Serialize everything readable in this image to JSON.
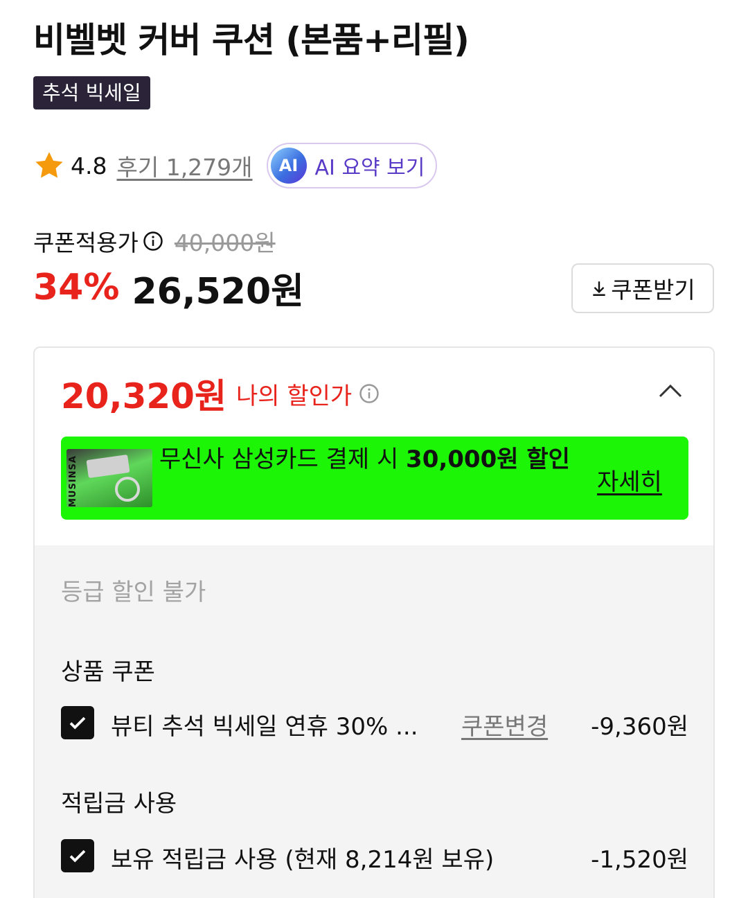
{
  "product": {
    "title": "비벨벳 커버 쿠션 (본품+리필)",
    "badge": "추석 빅세일"
  },
  "rating": {
    "icon": "star-icon",
    "value": "4.8",
    "review_link": "후기 1,279개",
    "ai_badge": "AI",
    "ai_summary_label": "AI 요약 보기"
  },
  "price": {
    "coupon_label": "쿠폰적용가",
    "original": "40,000원",
    "discount_rate": "34%",
    "sale": "26,520원",
    "coupon_button": "쿠폰받기"
  },
  "benefits": {
    "my_price": "20,320원",
    "my_price_label": "나의 할인가",
    "banner": {
      "image_brand": "MUSINSA",
      "text_prefix": "무신사 삼성카드 결제 시 ",
      "text_bold": "30,000원 할인",
      "detail_link": "자세히"
    },
    "grade_unavailable": "등급 할인 불가",
    "product_coupon_title": "상품 쿠폰",
    "product_coupon": {
      "checked": true,
      "text": "뷰티 추석 빅세일 연휴 30% ...",
      "change_link": "쿠폰변경",
      "amount": "-9,360원"
    },
    "points_title": "적립금 사용",
    "points": {
      "checked": true,
      "text": "보유 적립금 사용 (현재 8,214원 보유)",
      "amount": "-1,520원"
    }
  },
  "colors": {
    "accent_red": "#e8231c",
    "badge_bg": "#2b2438",
    "banner_green": "#1cf506",
    "ai_purple": "#5a3bc7",
    "star": "#f59a0c"
  }
}
